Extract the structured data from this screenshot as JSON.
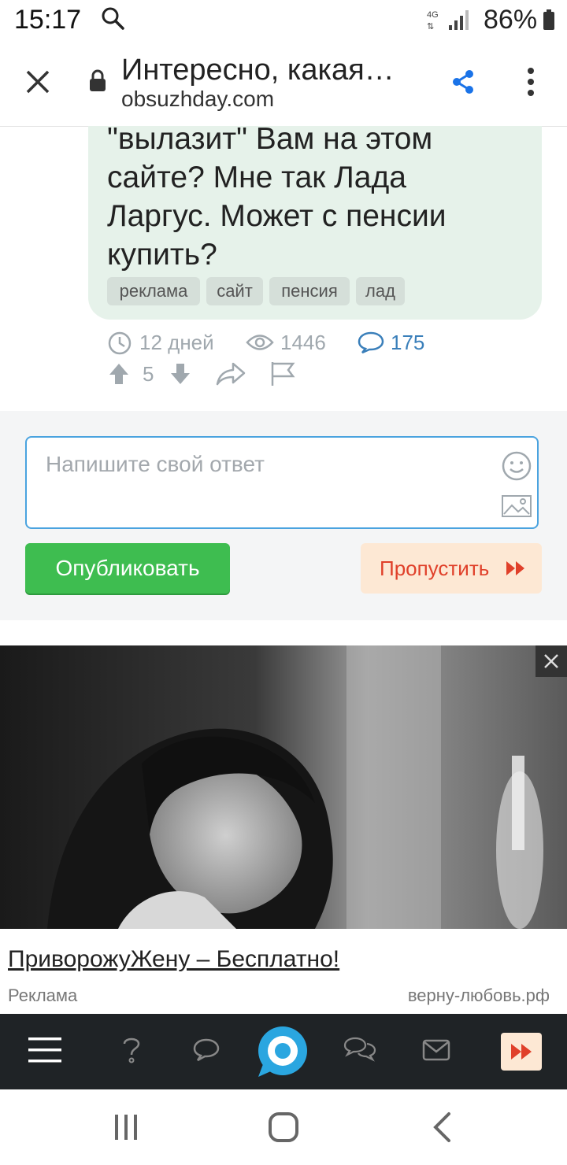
{
  "status_bar": {
    "time": "15:17",
    "network": "4G",
    "battery": "86%"
  },
  "browser": {
    "title": "Интересно, какая…",
    "url": "obsuzhday.com"
  },
  "post": {
    "text_lines": [
      "\"вылазит\" Вам на этом",
      "сайте? Мне так Лада",
      "Ларгус. Может с пенсии",
      "купить?"
    ],
    "tags": [
      "реклама",
      "сайт",
      "пенсия",
      "лад"
    ],
    "age": "12 дней",
    "views": "1446",
    "comments": "175",
    "votes": "5"
  },
  "reply": {
    "placeholder": "Напишите свой ответ",
    "publish_label": "Опубликовать",
    "skip_label": "Пропустить"
  },
  "ad": {
    "headline": "ПриворожуЖену – Бесплатно!",
    "label": "Реклама",
    "domain": "верну-любовь.рф"
  },
  "colors": {
    "accent_blue": "#4aa3df",
    "publish_green": "#3ebd50",
    "skip_red": "#e0402a",
    "nav_dark": "#1f2326",
    "nav_active": "#2aa6e0",
    "nav_skip_bg": "#fde8d4"
  },
  "icons": {
    "status": [
      "search-icon",
      "signal-icon",
      "battery-icon"
    ],
    "header": [
      "close-icon",
      "lock-icon",
      "share-icon",
      "more-vertical-icon"
    ],
    "meta": [
      "clock-icon",
      "eye-icon",
      "comment-icon",
      "upvote-icon",
      "downvote-icon",
      "share-arrow-icon",
      "flag-icon"
    ],
    "reply": [
      "emoji-icon",
      "image-icon",
      "fast-forward-icon"
    ],
    "bottom_nav": [
      "menu-icon",
      "question-icon",
      "chat-icon",
      "home-logo-icon",
      "conversations-icon",
      "mail-icon",
      "fast-forward-icon"
    ],
    "android_nav": [
      "recents-icon",
      "home-icon",
      "back-icon"
    ]
  }
}
